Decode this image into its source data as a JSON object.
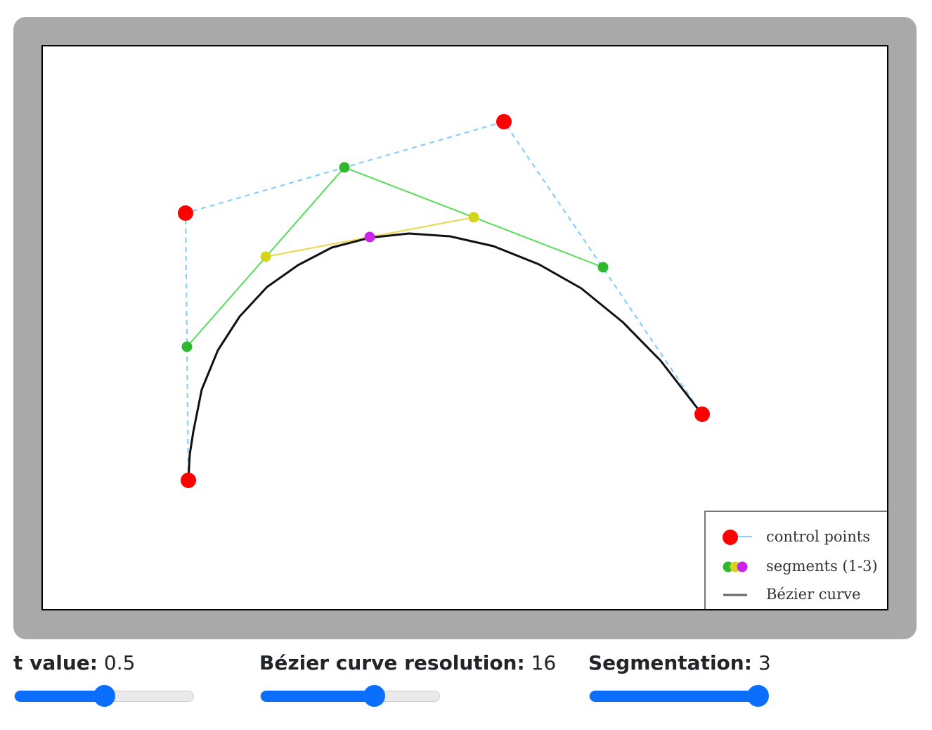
{
  "legend": {
    "control_points": "control points",
    "segments": "segments (1-3)",
    "curve": "Bézier curve"
  },
  "colors": {
    "frame": "#a9a9a9",
    "control_point": "#ff0000",
    "control_polygon": "#87cefa",
    "segment_1": "#2db82d",
    "segment_1_line": "#55dd55",
    "segment_2": "#d4d41a",
    "segment_2_line": "#e8d84a",
    "segment_3": "#cc22ee",
    "curve": "#111111",
    "slider_accent": "#0b6efd"
  },
  "controls": {
    "t_value": {
      "label": "t value:",
      "value": "0.5",
      "fraction": 0.5
    },
    "resolution": {
      "label": "Bézier curve resolution:",
      "value": "16",
      "fraction": 0.65
    },
    "segmentation": {
      "label": "Segmentation:",
      "value": "3",
      "fraction": 1.0
    }
  }
}
